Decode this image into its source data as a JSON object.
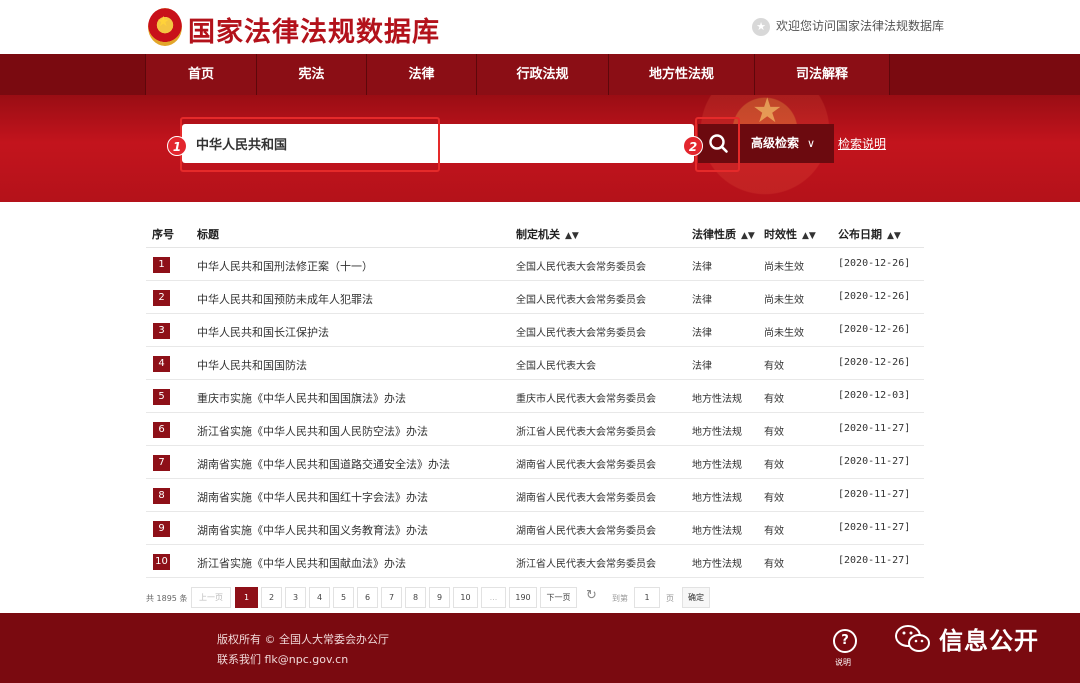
{
  "header": {
    "site_title": "国家法律法规数据库",
    "welcome": "欢迎您访问国家法律法规数据库"
  },
  "nav": {
    "items": [
      "首页",
      "宪法",
      "法律",
      "行政法规",
      "地方性法规",
      "司法解释"
    ]
  },
  "search": {
    "query": "中华人民共和国",
    "advanced_label": "高级检索",
    "help_link": "检索说明",
    "callout_1": "1",
    "callout_2": "2"
  },
  "table": {
    "columns": {
      "index": "序号",
      "title": "标题",
      "org": "制定机关",
      "type": "法律性质",
      "status": "时效性",
      "date": "公布日期"
    },
    "rows": [
      {
        "num": "1",
        "title": "中华人民共和国刑法修正案（十一）",
        "org": "全国人民代表大会常务委员会",
        "type": "法律",
        "status": "尚未生效",
        "date": "[2020-12-26]"
      },
      {
        "num": "2",
        "title": "中华人民共和国预防未成年人犯罪法",
        "org": "全国人民代表大会常务委员会",
        "type": "法律",
        "status": "尚未生效",
        "date": "[2020-12-26]"
      },
      {
        "num": "3",
        "title": "中华人民共和国长江保护法",
        "org": "全国人民代表大会常务委员会",
        "type": "法律",
        "status": "尚未生效",
        "date": "[2020-12-26]"
      },
      {
        "num": "4",
        "title": "中华人民共和国国防法",
        "org": "全国人民代表大会",
        "type": "法律",
        "status": "有效",
        "date": "[2020-12-26]"
      },
      {
        "num": "5",
        "title": "重庆市实施《中华人民共和国国旗法》办法",
        "org": "重庆市人民代表大会常务委员会",
        "type": "地方性法规",
        "status": "有效",
        "date": "[2020-12-03]"
      },
      {
        "num": "6",
        "title": "浙江省实施《中华人民共和国人民防空法》办法",
        "org": "浙江省人民代表大会常务委员会",
        "type": "地方性法规",
        "status": "有效",
        "date": "[2020-11-27]"
      },
      {
        "num": "7",
        "title": "湖南省实施《中华人民共和国道路交通安全法》办法",
        "org": "湖南省人民代表大会常务委员会",
        "type": "地方性法规",
        "status": "有效",
        "date": "[2020-11-27]"
      },
      {
        "num": "8",
        "title": "湖南省实施《中华人民共和国红十字会法》办法",
        "org": "湖南省人民代表大会常务委员会",
        "type": "地方性法规",
        "status": "有效",
        "date": "[2020-11-27]"
      },
      {
        "num": "9",
        "title": "湖南省实施《中华人民共和国义务教育法》办法",
        "org": "湖南省人民代表大会常务委员会",
        "type": "地方性法规",
        "status": "有效",
        "date": "[2020-11-27]"
      },
      {
        "num": "10",
        "title": "浙江省实施《中华人民共和国献血法》办法",
        "org": "浙江省人民代表大会常务委员会",
        "type": "地方性法规",
        "status": "有效",
        "date": "[2020-11-27]"
      }
    ]
  },
  "pagination": {
    "total": "共 1895 条",
    "prev": "上一页",
    "pages": [
      "1",
      "2",
      "3",
      "4",
      "5",
      "6",
      "7",
      "8",
      "9",
      "10",
      "...",
      "190"
    ],
    "current_page": "1",
    "next": "下一页",
    "goto_label": "到第",
    "goto_value": "1",
    "page_unit": "页",
    "confirm": "确定"
  },
  "footer": {
    "copyright": "版权所有 © 全国人大常委会办公厅",
    "contact": "联系我们 flk@npc.gov.cn",
    "help_label": "说明",
    "help_icon": "?",
    "wechat_account": "信息公开"
  },
  "colors": {
    "brand_red": "#b3121b",
    "nav_dark": "#7a0a10",
    "callout_red": "#e52a2a"
  }
}
